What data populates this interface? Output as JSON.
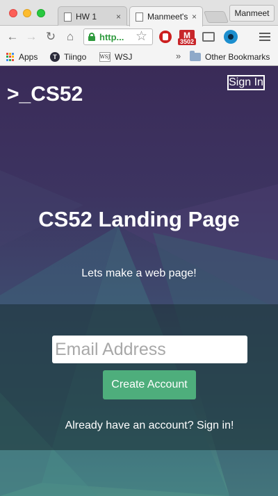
{
  "browser": {
    "tabs": [
      {
        "title": "HW 1",
        "close": "×"
      },
      {
        "title": "Manmeet's",
        "close": "×"
      }
    ],
    "profile_name": "Manmeet",
    "url": "http...",
    "gmail": {
      "letter": "M",
      "count": "3502"
    },
    "bookmarks": [
      {
        "label": "Apps",
        "icon": "apps-grid-icon"
      },
      {
        "label": "Tiingo",
        "icon": "tiingo-icon",
        "icon_letter": "T"
      },
      {
        "label": "WSJ",
        "icon": "wsj-icon",
        "icon_text": "WSJ"
      }
    ],
    "bookmarks_overflow": "»",
    "other_bookmarks": "Other Bookmarks"
  },
  "page": {
    "brand": ">_CS52",
    "signin_label": "Sign In",
    "title": "CS52 Landing Page",
    "subtitle": "Lets make a web page!",
    "email_placeholder": "Email Address",
    "create_account_label": "Create Account",
    "already_text": "Already have an account? Sign in!"
  },
  "colors": {
    "accent_green": "#4eae7c",
    "bg_top": "#3a2b58",
    "bg_bottom": "#4d8c86"
  }
}
